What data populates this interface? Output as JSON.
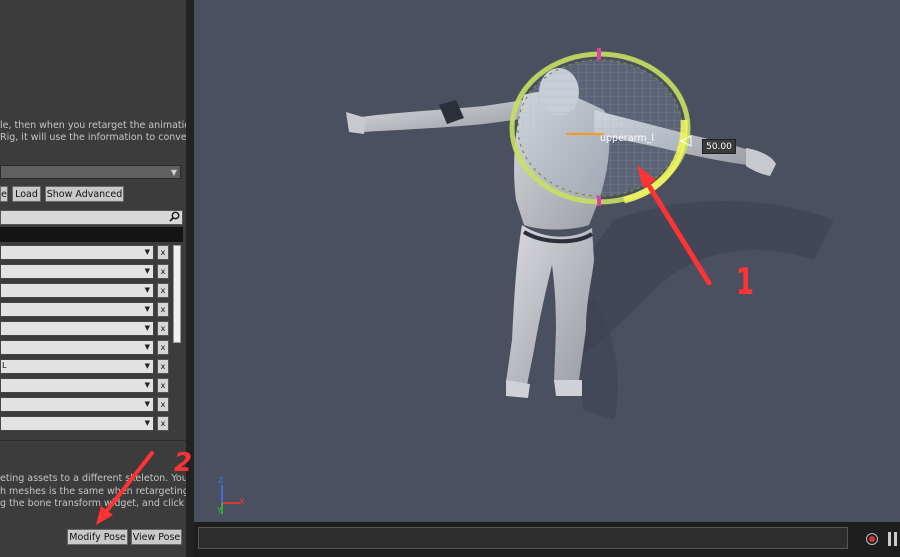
{
  "left_panel": {
    "description_lines": [
      "le, then when you retarget the animation",
      "Rig, it will use the information to convert"
    ],
    "buttons": {
      "save_partial": "e",
      "load": "Load",
      "show_advanced": "Show Advanced"
    },
    "bone_rows": [
      {
        "target": ""
      },
      {
        "target": ""
      },
      {
        "target": ""
      },
      {
        "target": ""
      },
      {
        "target": ""
      },
      {
        "target": ""
      },
      {
        "target": "L"
      },
      {
        "target": ""
      },
      {
        "target": ""
      },
      {
        "target": ""
      }
    ],
    "clear_label": "x",
    "pose_help_lines": [
      "eting assets to a different skeleton. You",
      "h meshes is the same when retargeting,",
      "g the bone transform widget, and click"
    ],
    "modify_pose": "Modify Pose",
    "view_pose": "View Pose"
  },
  "viewport": {
    "bone_label": "upperarm_l",
    "scale_value": "50.00",
    "axis_labels": {
      "x": "X",
      "y": "Y",
      "z": "Z"
    }
  },
  "annotations": {
    "one": "1",
    "two": "2"
  },
  "colors": {
    "viewport_bg": "#4b5061",
    "panel_bg": "#3c3c3c",
    "gizmo": "#c8e060",
    "annotation": "#ff3333"
  }
}
